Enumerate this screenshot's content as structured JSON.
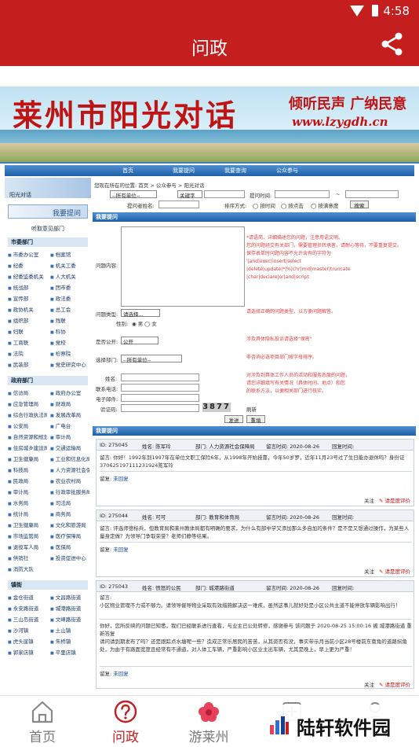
{
  "status_bar": {
    "time": "4:58"
  },
  "app_bar": {
    "title": "问政"
  },
  "banner": {
    "title": "莱州市阳光对话",
    "slogan": "倾听民声 广纳民意",
    "url": "www.lzygdh.cn"
  },
  "top_nav": [
    "首页",
    "我要提问",
    "我要查询",
    "公众参与"
  ],
  "sidebar": {
    "header": "阳光对话",
    "ask_button": "我要提问",
    "title": "听取意见部门",
    "categories": [
      {
        "name": "市委部门",
        "items": [
          "市委办公室",
          "档案馆",
          "纪委",
          "机关工委",
          "纪委监委机关",
          "人大机关",
          "统战部",
          "团市委",
          "宣传部",
          "政法委",
          "政协机关",
          "总工会",
          "组织部",
          "残联",
          "妇联",
          "科协",
          "工商联",
          "党校",
          "法院",
          "检察院",
          "武装部",
          "党史研究中心"
        ]
      },
      {
        "name": "政府部门",
        "items": [
          "信访局",
          "政府办公室",
          "应急管理局",
          "财政局",
          "综合行政执法局",
          "发展改革局",
          "公安局",
          "广电台",
          "自然资源和规划局",
          "审计局",
          "住房城乡建设局",
          "交通运输局",
          "卫生健康局",
          "工业和信息化局",
          "科技局",
          "人力资源社会保障局",
          "民政局",
          "农业农村局",
          "审计局",
          "行政审批服务局",
          "水务局",
          "司法局",
          "统计局",
          "商务局",
          "卫生健康局",
          "文化和旅游局",
          "市场监管局",
          "医疗保障局",
          "退役军人局",
          "医保局",
          "供销社",
          "投资促进中心",
          "消防大队"
        ]
      },
      {
        "name": "镇街",
        "items": [
          "金仓街道",
          "文昌路街道",
          "永安路街道",
          "城港路街道",
          "三山岛街道",
          "文峰路街道",
          "沙河镇",
          "土山镇",
          "虎头崖镇",
          "朱桥镇",
          "郭家店镇",
          "平里店镇"
        ]
      }
    ]
  },
  "content": {
    "breadcrumb": "您现在所在的位置: 首页 > 公众参与 > 阳光对话",
    "filter": {
      "unit_select": "--所有单位--",
      "keyword_select": "关键字",
      "time_label": "提问时间:",
      "dash": "~",
      "name_label": "提问者姓名:",
      "sort_label": "排序方式:",
      "sort_options": [
        "按时间",
        "按点击",
        "按满意度"
      ],
      "search_button": "搜索"
    },
    "ask_section": {
      "title": "我要提问",
      "content_label": "问题内容:",
      "content_hints": [
        "*请语简，详细描述您的问题，注意用语文明。",
        "您的问题经交有关部门，需要管理员转承者，请耐心等待，不要重复提交。",
        "保存表单时问题内容不允许含有的字符为",
        "'|and|exec|insert|select",
        "|delete|update|*|%|chr|mid|master|truncate",
        "|char|declare|or|and|script"
      ],
      "type_label": "问题类型:",
      "type_select": "请选择...",
      "type_hint": "请选择正确的问题类型，以方便问题解答。",
      "gender_label": "性别:",
      "gender_options": [
        "男",
        "女"
      ],
      "public_label": "是否公开:",
      "public_select": "公开",
      "public_hint": "涉及具体隐私投诉请选择\"保密\"",
      "dept_label": "选择部门:",
      "dept_select": "--所有单位--",
      "dept_hint": "非咨询必选项目部门按字母排序。",
      "name_label": "姓名:",
      "phone_label": "联系电话:",
      "email_label": "电子邮件:",
      "captcha_label": "验证码:",
      "captcha": "3877",
      "refresh": "刷新",
      "id_hints": [
        "对涉及到具体工作人员的活动和服务态度的问题，",
        "请您详细填写有关情况（具体时间、地点）和您",
        "的联系方法，以便相关部门进行核实。"
      ],
      "submit": "发送",
      "reset": "重填"
    },
    "answers_section": {
      "title": "我要提问",
      "items": [
        {
          "id": "ID: 275045",
          "name": "姓名: 陈军玲",
          "dept": "部门: 人力资源社会保障局",
          "time": "留言时间: 2020-08-26",
          "status": "回复时间:",
          "q_label": "留言:",
          "question": "你好！1992年到1997年在单位文职工保险6年，从1998年开始挂靠，今年50岁罗，近年11月23号过了生日能办退休吗？身份证370625197111231924陈军玲",
          "reply_label": "留复:",
          "reply": "未回复",
          "follow": "关注",
          "evaluate": "请是度评价"
        },
        {
          "id": "ID: 275044",
          "name": "姓名: 可可",
          "dept": "部门: 教育和体育局",
          "time": "留言时间: 2020-08-26",
          "status": "回复时间:",
          "q_label": "留言:",
          "question": "评选师德标兵，但教育局和莱州教体局都有明确的要求，为什么有部中学又添加那么多自加的条件？是不是又想通过操作，为某些人量身定做？为领导门争取荣誉？老师们静等结果。",
          "reply_label": "留复:",
          "reply": "未回复",
          "follow": "关注",
          "evaluate": "请是度评价"
        },
        {
          "id": "ID: 275043",
          "name": "姓名: 愤怒的公民",
          "dept": "部门: 城港路街道",
          "time": "留言时间: 2020-08-26",
          "status": "回复时间:",
          "q_label": "留言:",
          "question": "小区物业管理不力或不够力。请领导督导物业采取有效措施解决这一难疾，虽然这事儿就好处是小区公共主道不能停放车辆影响出行！",
          "question2": "你好，您所反映的问题已知悉，我们已经联系进行查看，与业主已公处转修，感谢参与 该问题于 2020-08-25 15:00:16 被 城港路街道 重新答复",
          "question3": "请问请到期发布了吗？还是跟踪点水塘呢一些？造成正常乐居民的苦苦，从其资否有没，事实带示月当前小区28号楼前东南角的道路拐角处，为由于有路面宽度且经常有不通道，对人体工车辆，严重影响小区业主出车辆，尤其是晚上，早上更为严重！",
          "reply_label": "留复:",
          "reply": "未回复",
          "follow": "关注",
          "evaluate": "请是度评价"
        }
      ]
    }
  },
  "bottom_nav": [
    {
      "label": "首页",
      "icon": "home-icon"
    },
    {
      "label": "问政",
      "icon": "question-icon",
      "active": true
    },
    {
      "label": "游莱州",
      "icon": "flower-icon"
    },
    {
      "label": "",
      "icon": "plus-icon"
    },
    {
      "label": "",
      "icon": "user-icon"
    }
  ],
  "watermark": {
    "text": "陆轩软件园"
  },
  "colors": {
    "brand": "#c41e1e",
    "nav_blue": "#1f5fa8",
    "hint_red": "#e04040"
  }
}
